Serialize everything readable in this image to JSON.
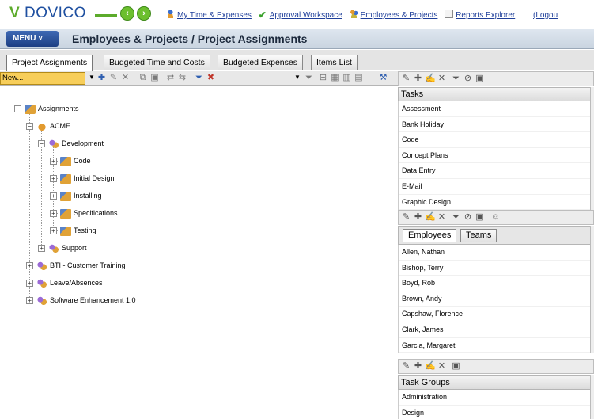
{
  "app": {
    "logo_v": "V",
    "logo_text": "DOVICO"
  },
  "top_links": {
    "my_time": "My Time & Expenses",
    "approval": "Approval Workspace",
    "employees_projects": "Employees & Projects",
    "reports": "Reports Explorer",
    "logout": "(Logou"
  },
  "menubar": {
    "menu_label": "MENU ˅",
    "page_title": "Employees & Projects / Project Assignments"
  },
  "tabs": [
    {
      "label": "Project Assignments",
      "active": true
    },
    {
      "label": "Budgeted Time and Costs",
      "active": false
    },
    {
      "label": "Budgeted Expenses",
      "active": false
    },
    {
      "label": "Items List",
      "active": false
    }
  ],
  "left_toolbar": {
    "new_value": "New..."
  },
  "tree": {
    "root": "Assignments",
    "client": "ACME",
    "project_development": "Development",
    "tasks": [
      "Code",
      "Initial Design",
      "Installing",
      "Specifications",
      "Testing"
    ],
    "project_support": "Support",
    "other_projects": [
      "BTI - Customer Training",
      "Leave/Absences",
      "Software Enhancement 1.0"
    ]
  },
  "tasks_panel": {
    "header": "Tasks",
    "items": [
      "Assessment",
      "Bank Holiday",
      "Code",
      "Concept Plans",
      "Data Entry",
      "E-Mail",
      "Graphic Design"
    ]
  },
  "employees_panel": {
    "tab_employees": "Employees",
    "tab_teams": "Teams",
    "items": [
      "Allen, Nathan",
      "Bishop, Terry",
      "Boyd, Rob",
      "Brown, Andy",
      "Capshaw, Florence",
      "Clark, James",
      "Garcia, Margaret"
    ]
  },
  "task_groups_panel": {
    "header": "Task Groups",
    "items": [
      "Administration",
      "Design"
    ]
  },
  "colors": {
    "brand_blue": "#1e4fa0",
    "brand_green": "#5cab2b",
    "new_select_bg": "#f7ce5a"
  }
}
